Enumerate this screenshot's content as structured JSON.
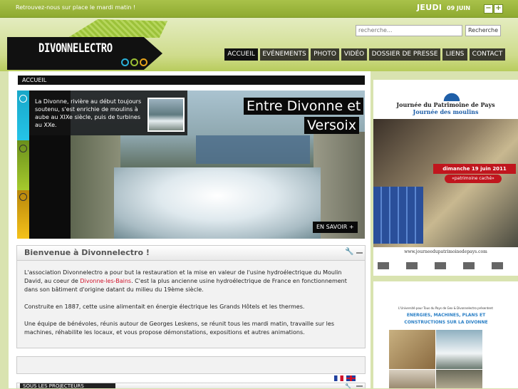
{
  "topbar": {
    "tagline": "Retrouvez-nous sur place le mardi matin !",
    "day": "JEUDI",
    "date": "09 JUIN",
    "decrease": "−",
    "increase": "+"
  },
  "logo": {
    "text": "DIVONNELECTRO"
  },
  "search": {
    "placeholder": "recherche...",
    "button": "Recherche"
  },
  "nav": [
    "ACCUEIL",
    "EVÉNEMENTS",
    "PHOTO",
    "VIDÉO",
    "DOSSIER DE PRESSE",
    "LIENS",
    "CONTACT"
  ],
  "breadcrumb": "ACCUEIL",
  "slide": {
    "description": "La Divonne, rivière au début toujours soutenu, s'est enrichie de moulins à aube au XIXe siècle, puis de turbines au XXe.",
    "title_line1": "Entre Divonne et",
    "title_line2": "Versoix",
    "more": "EN SAVOIR +"
  },
  "welcome": {
    "title": "Bienvenue à Divonnelectro !",
    "p1a": "L'association Divonnelectro a pour but la restauration et la mise en valeur de l'usine hydroélectrique du Moulin David, au coeur de ",
    "p1link": "Divonne-les-Bains",
    "p1b": ". C'est la plus ancienne usine hydroélectrique de France en fonctionnement dans son bâtiment d'origine datant du milieu du 19ème siècle.",
    "p2": "Construite en 1887, cette usine alimentait en énergie électrique les Grands Hôtels et les thermes.",
    "p3": "Une équipe de bénévoles, réunis autour de Georges Leskens, se réunit tous les mardi matin, travaille sur les machines, réhabilite les locaux, et vous propose démonstations, expositions et autres animations."
  },
  "bottom_panel": {
    "title": "SOUS LES PROJECTEURS"
  },
  "ad1": {
    "title1": "Journée du Patrimoine de Pays",
    "title2": "Journée des moulins",
    "date": "dimanche 19 juin 2011",
    "subtitle": "«patrimoine caché»",
    "url": "www.journeedupatrimoinedepays.com"
  },
  "ad2": {
    "intro": "L'Université pour Tous du Pays de Gex & Divonnelectro présentent",
    "headline": "ENERGIES, MACHINES, PLANS ET CONSTRUCTIONS SUR LA DIVONNE"
  },
  "colors": {
    "accent_green": "#9cbf34",
    "nav_bg": "#3a3a2e",
    "link_red": "#d0122a"
  }
}
